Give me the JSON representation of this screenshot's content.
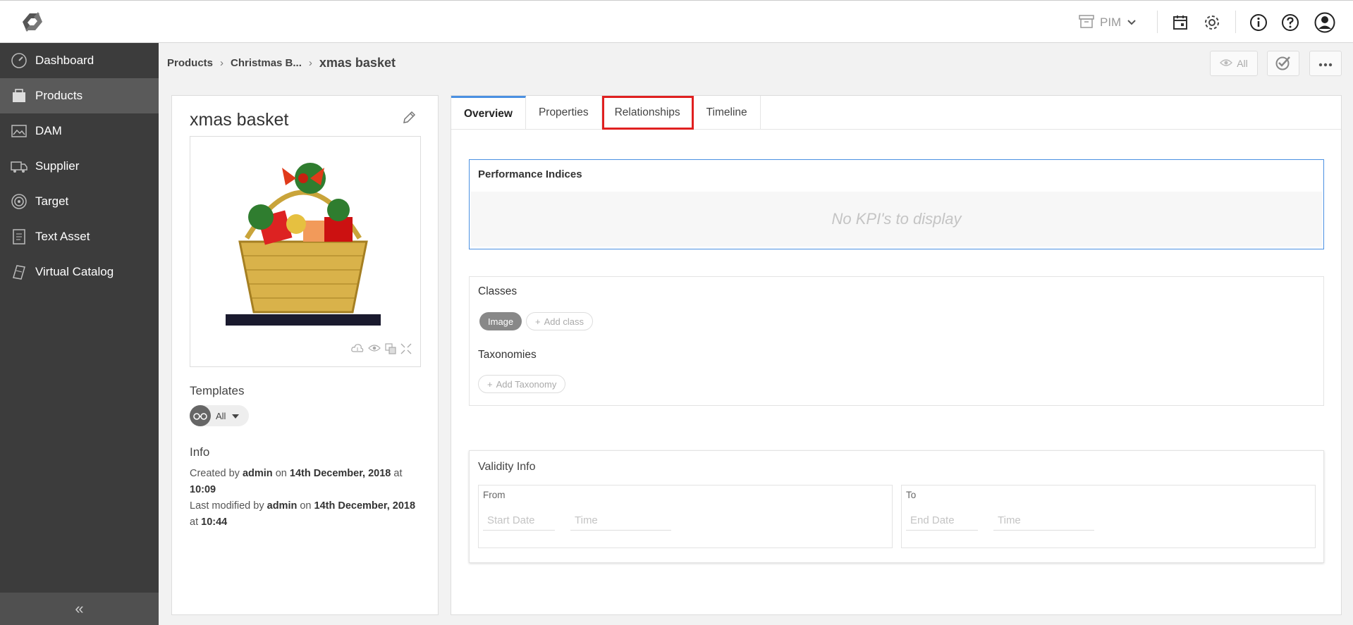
{
  "topbar": {
    "module_label": "PIM",
    "icons": [
      "logo-icon",
      "archive-icon",
      "calendar-icon",
      "settings-icon",
      "info-icon",
      "help-icon",
      "user-icon"
    ]
  },
  "sidebar": {
    "items": [
      {
        "label": "Dashboard",
        "icon": "dashboard-icon"
      },
      {
        "label": "Products",
        "icon": "products-icon"
      },
      {
        "label": "DAM",
        "icon": "image-icon"
      },
      {
        "label": "Supplier",
        "icon": "truck-icon"
      },
      {
        "label": "Target",
        "icon": "target-icon"
      },
      {
        "label": "Text Asset",
        "icon": "document-icon"
      },
      {
        "label": "Virtual Catalog",
        "icon": "catalog-icon"
      }
    ],
    "active_index": 1,
    "collapse_glyph": "«"
  },
  "breadcrumb": {
    "items": [
      "Products",
      "Christmas B..."
    ],
    "separator": "›",
    "current": "xmas basket"
  },
  "header_actions": {
    "view_label": "All"
  },
  "item": {
    "title": "xmas basket",
    "templates_label": "Templates",
    "template_value": "All",
    "info_label": "Info",
    "created_prefix": "Created by",
    "created_user": "admin",
    "created_on": "on",
    "created_date": "14th December, 2018",
    "created_at": "at",
    "created_time": "10:09",
    "modified_prefix": "Last modified by",
    "modified_user": "admin",
    "modified_on": "on",
    "modified_date": "14th December, 2018",
    "modified_at": "at",
    "modified_time": "10:44"
  },
  "tabs": [
    {
      "label": "Overview",
      "active": true
    },
    {
      "label": "Properties",
      "active": false
    },
    {
      "label": "Relationships",
      "active": false,
      "highlighted": true
    },
    {
      "label": "Timeline",
      "active": false
    }
  ],
  "performance": {
    "title": "Performance Indices",
    "empty_text": "No KPI's to display"
  },
  "classes": {
    "title": "Classes",
    "chip": "Image",
    "add_class": "Add class",
    "taxonomies_title": "Taxonomies",
    "add_taxonomy": "Add Taxonomy"
  },
  "validity": {
    "title": "Validity Info",
    "from_label": "From",
    "to_label": "To",
    "start_date_placeholder": "Start Date",
    "end_date_placeholder": "End Date",
    "time_placeholder": "Time"
  },
  "colors": {
    "sidebar_bg": "#3c3c3c",
    "active_tab_accent": "#4a90e2",
    "highlight_outline": "#e02020"
  }
}
